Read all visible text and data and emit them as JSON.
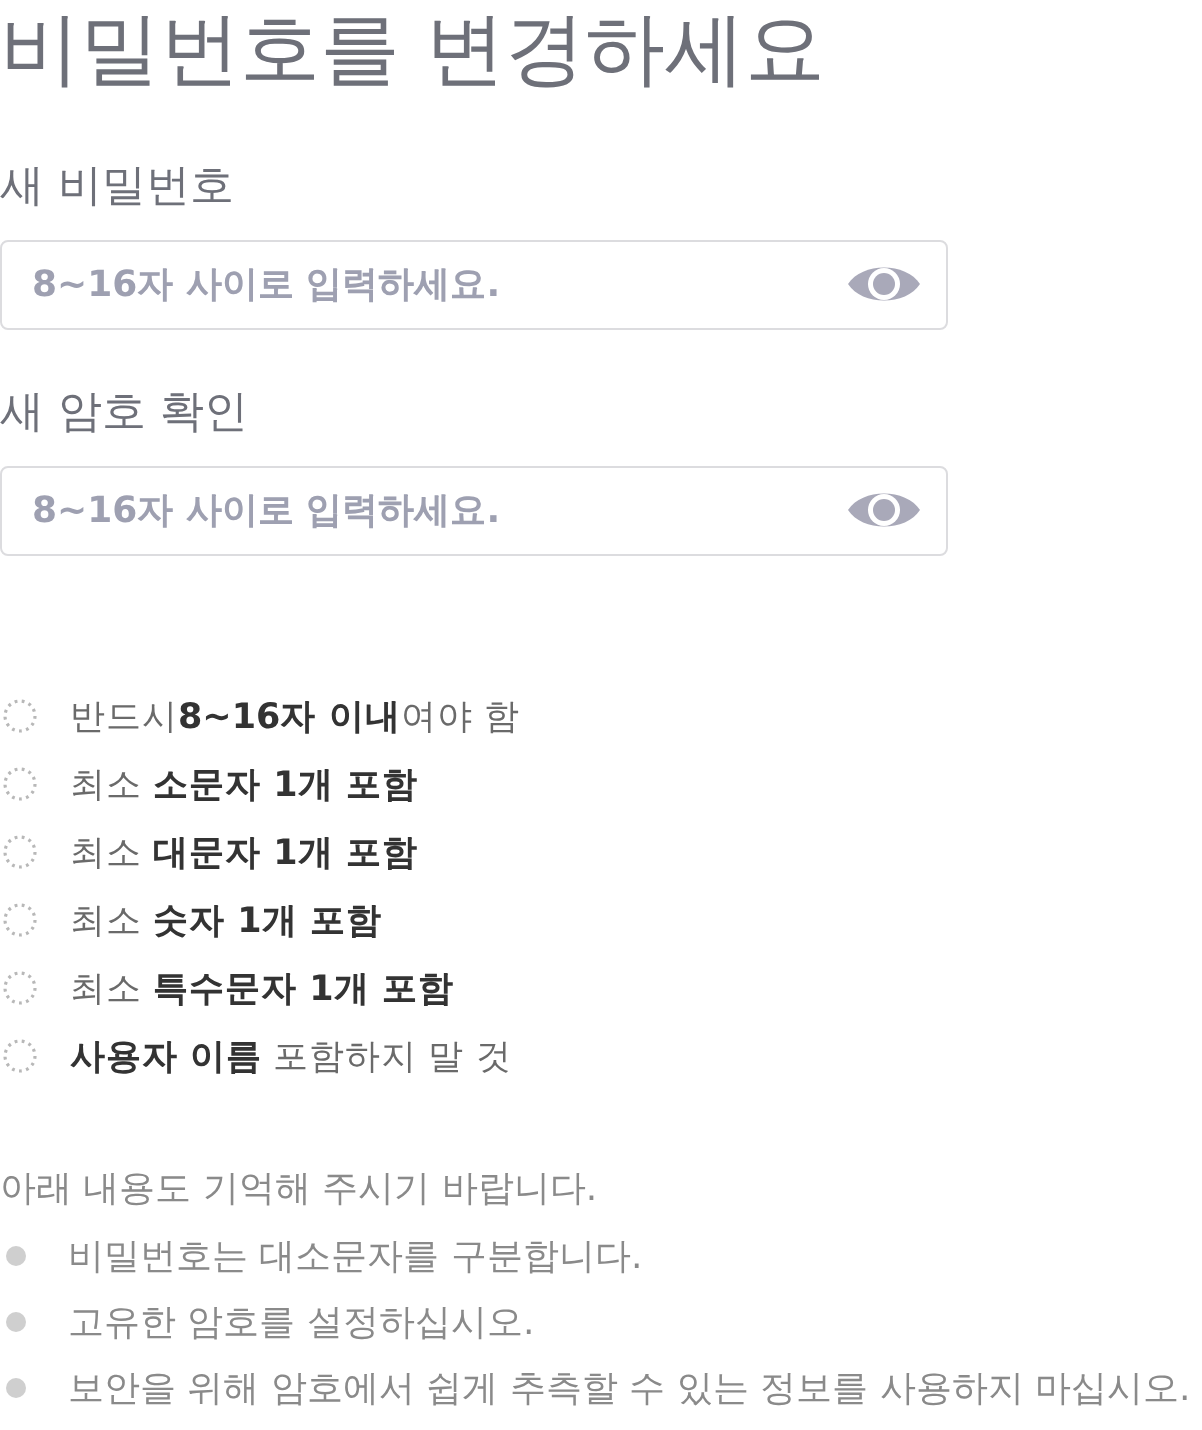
{
  "title": "비밀번호를 변경하세요",
  "fields": [
    {
      "label": "새 비밀번호",
      "placeholder": "8~16자 사이로 입력하세요."
    },
    {
      "label": "새 암호 확인",
      "placeholder": "8~16자 사이로 입력하세요."
    }
  ],
  "requirements": [
    {
      "text": "반드시**8~16자 이내**여야 함",
      "satisfied": false
    },
    {
      "text": "최소 **소문자 1개 포함**",
      "satisfied": false
    },
    {
      "text": "최소 **대문자 1개 포함**",
      "satisfied": false
    },
    {
      "text": "최소 **숫자 1개 포함**",
      "satisfied": false
    },
    {
      "text": "최소 **특수문자 1개 포함**",
      "satisfied": false
    },
    {
      "text": "**사용자 이름** 포함하지 말 것",
      "satisfied": false
    }
  ],
  "note": {
    "text": "아래 내용도 기억해 주시기 바랍니다.",
    "items": [
      "비밀번호는 대소문자를 구분합니다.",
      "고유한 암호를 설정하십시오.",
      "보안을 위해 암호에서 쉽게 추측할 수 있는 정보를 사용하지 마십시오."
    ]
  }
}
